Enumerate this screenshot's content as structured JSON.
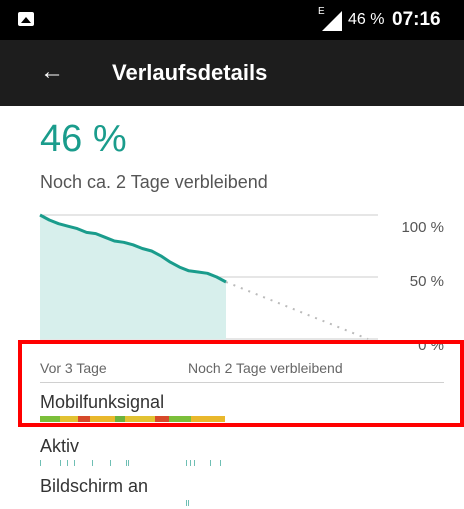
{
  "status_bar": {
    "gallery_icon": "image-icon",
    "network": "E",
    "battery": "46 %",
    "time": "07:16"
  },
  "app_bar": {
    "back_icon": "arrow-left-icon",
    "title": "Verlaufsdetails"
  },
  "battery": {
    "percent": "46 %",
    "remaining": "Noch ca. 2 Tage verbleibend"
  },
  "chart_data": {
    "type": "line",
    "y_ticks": [
      "100 %",
      "50 %",
      "0 %"
    ],
    "ylim": [
      0,
      100
    ],
    "series": [
      {
        "values": [
          100,
          96,
          93,
          91,
          89,
          86,
          85,
          82,
          79,
          78,
          76,
          73,
          71,
          67,
          62,
          58,
          55,
          54,
          53,
          50,
          46
        ]
      },
      {
        "style": "dotted",
        "values": [
          46,
          0
        ]
      }
    ],
    "colors": {
      "line": "#1a9c8c",
      "fill": "#d7efec",
      "grid": "#cccccc",
      "projection": "#bbbbbb"
    }
  },
  "labels": {
    "start": "Vor 3 Tage",
    "end": "Noch 2 Tage verbleibend"
  },
  "rows": {
    "mobile_signal": "Mobilfunksignal",
    "active": "Aktiv",
    "screen_on": "Bildschirm an"
  }
}
